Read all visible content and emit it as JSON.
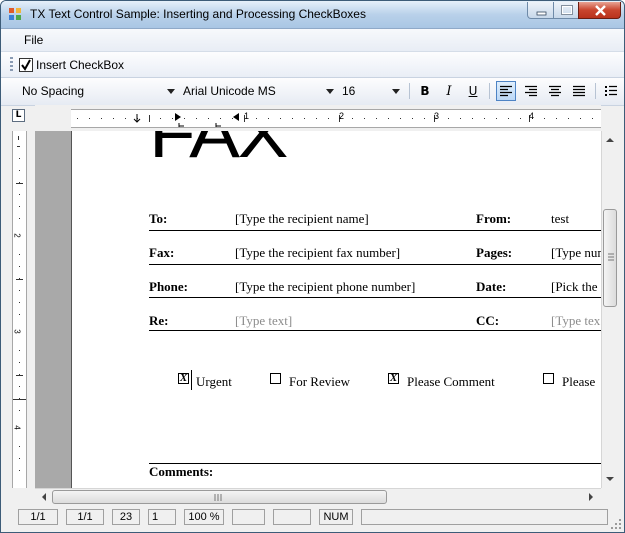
{
  "window": {
    "title": "TX Text Control Sample: Inserting and Processing CheckBoxes"
  },
  "menu": {
    "file": "File"
  },
  "toolbar": {
    "insert_checkbox": "Insert CheckBox"
  },
  "format": {
    "style": "No Spacing",
    "font": "Arial Unicode MS",
    "size": "16",
    "bold": "B",
    "italic": "I",
    "underline": "U",
    "active_align": "left"
  },
  "ruler": {
    "h_numbers": [
      "1",
      "2",
      "3",
      "4"
    ],
    "v_numbers": [
      "2",
      "3",
      "4"
    ]
  },
  "document": {
    "heading": "FAX",
    "rows": [
      {
        "label": "To:",
        "value": "[Type the recipient name]",
        "label2": "From:",
        "value2": "test",
        "placeholder": false,
        "placeholder2": false
      },
      {
        "label": "Fax:",
        "value": "[Type the recipient fax number]",
        "label2": "Pages:",
        "value2": "[Type num",
        "placeholder": false,
        "placeholder2": false
      },
      {
        "label": "Phone:",
        "value": "[Type the recipient phone number]",
        "label2": "Date:",
        "value2": "[Pick the",
        "placeholder": false,
        "placeholder2": false
      },
      {
        "label": "Re:",
        "value": "[Type text]",
        "label2": "CC:",
        "value2": "[Type tex",
        "placeholder": true,
        "placeholder2": true
      }
    ],
    "checkboxes": [
      {
        "label": "Urgent",
        "checked": true,
        "mark": "X"
      },
      {
        "label": "For Review",
        "checked": false,
        "mark": ""
      },
      {
        "label": "Please Comment",
        "checked": true,
        "mark": "X"
      },
      {
        "label": "Please",
        "checked": false,
        "mark": ""
      }
    ],
    "comments_label": "Comments:"
  },
  "statusbar": {
    "page": "1/1",
    "section": "1/1",
    "line": "23",
    "column": "1",
    "zoom": "100 %",
    "num": "NUM"
  }
}
